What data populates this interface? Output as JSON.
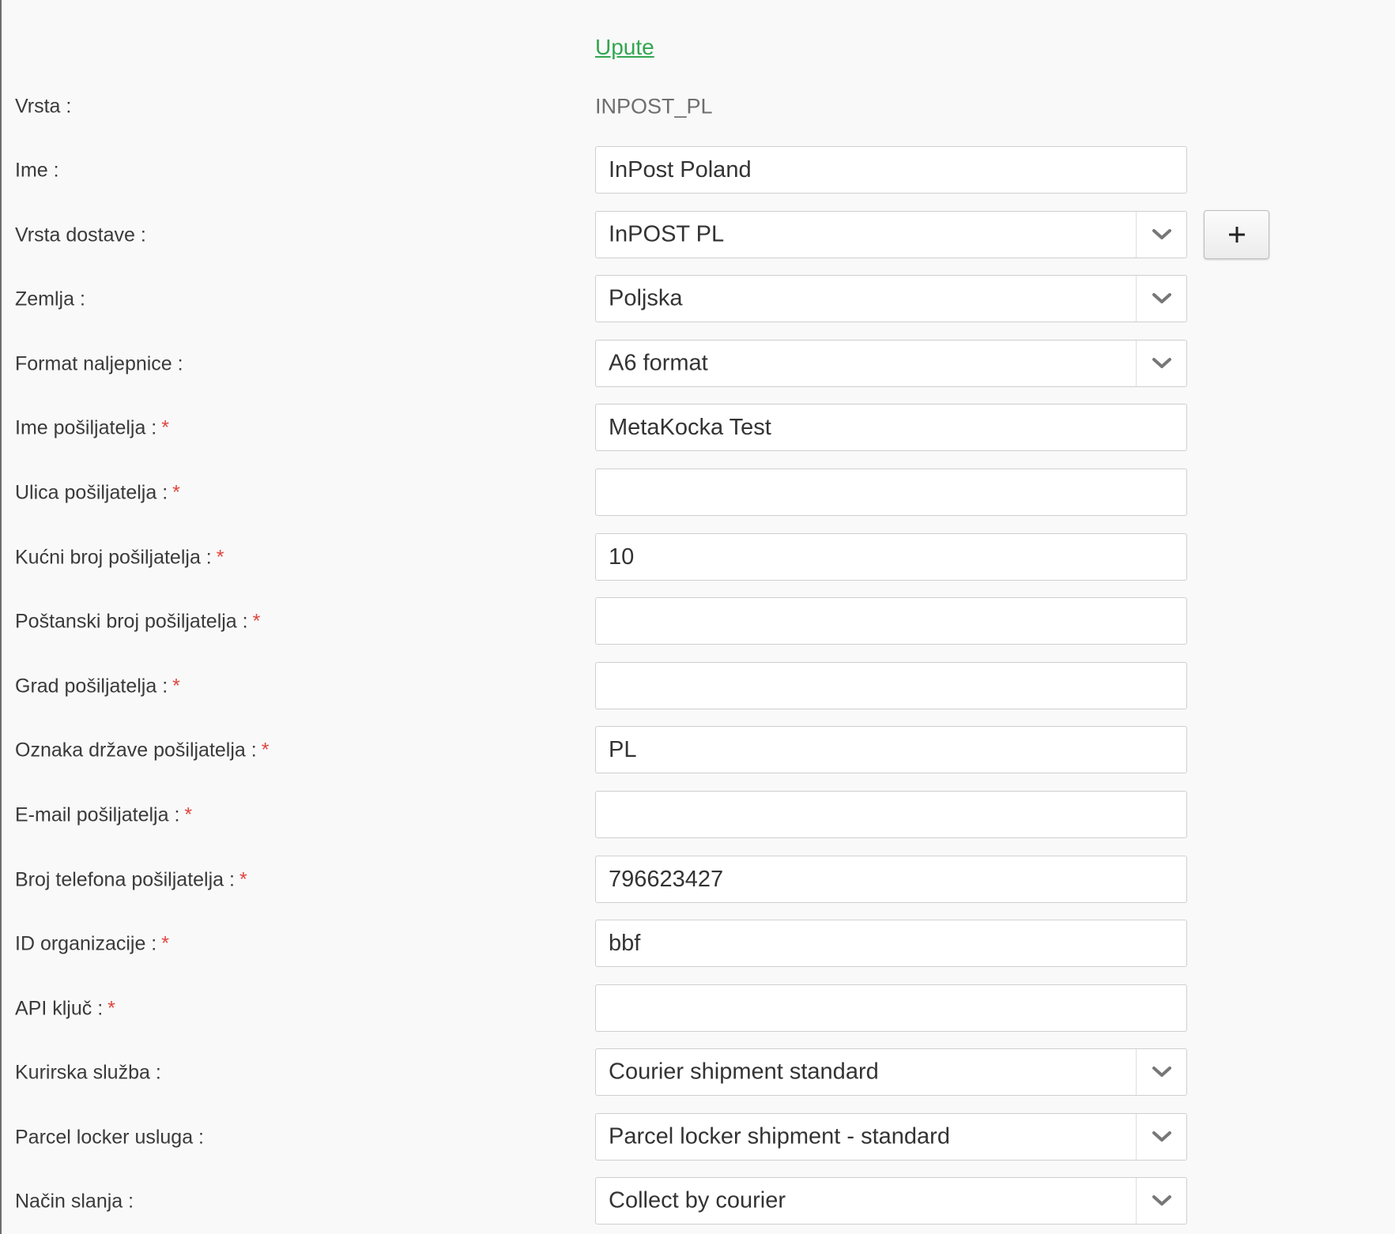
{
  "link": {
    "label": "Upute"
  },
  "vrsta": {
    "label": "Vrsta :",
    "value": "INPOST_PL"
  },
  "fields": {
    "ime": {
      "label": "Ime :",
      "value": "InPost Poland"
    },
    "vrsta_dostave": {
      "label": "Vrsta dostave :",
      "value": "InPOST PL",
      "add_label": "+"
    },
    "zemlja": {
      "label": "Zemlja :",
      "value": "Poljska"
    },
    "format_naljepnice": {
      "label": "Format naljepnice :",
      "value": "A6 format"
    },
    "ime_posiljatelja": {
      "label": "Ime pošiljatelja :",
      "required": "*",
      "value": "MetaKocka Test"
    },
    "ulica_posiljatelja": {
      "label": "Ulica pošiljatelja :",
      "required": "*",
      "value": ""
    },
    "kucni_broj": {
      "label": "Kućni broj pošiljatelja :",
      "required": "*",
      "value": "10"
    },
    "postanski_broj": {
      "label": "Poštanski broj pošiljatelja :",
      "required": "*",
      "value": ""
    },
    "grad": {
      "label": "Grad pošiljatelja :",
      "required": "*",
      "value": ""
    },
    "oznaka_drzave": {
      "label": "Oznaka države pošiljatelja :",
      "required": "*",
      "value": "PL"
    },
    "email": {
      "label": "E-mail pošiljatelja :",
      "required": "*",
      "value": ""
    },
    "telefon": {
      "label": "Broj telefona pošiljatelja :",
      "required": "*",
      "value": "796623427"
    },
    "id_organizacije": {
      "label": "ID organizacije :",
      "required": "*",
      "value": "bbf"
    },
    "api_kljuc": {
      "label": "API ključ :",
      "required": "*",
      "value": ""
    },
    "kurirska_sluzba": {
      "label": "Kurirska služba :",
      "value": "Courier shipment standard"
    },
    "parcel_locker": {
      "label": "Parcel locker usluga :",
      "value": "Parcel locker shipment - standard"
    },
    "nacin_slanja": {
      "label": "Način slanja :",
      "value": "Collect by courier"
    }
  },
  "colors": {
    "link": "#33a650",
    "required": "#e0453e",
    "background": "#f9f9f9"
  },
  "icons": {
    "select_arrow": "chevron-down-icon",
    "add": "plus-icon"
  }
}
